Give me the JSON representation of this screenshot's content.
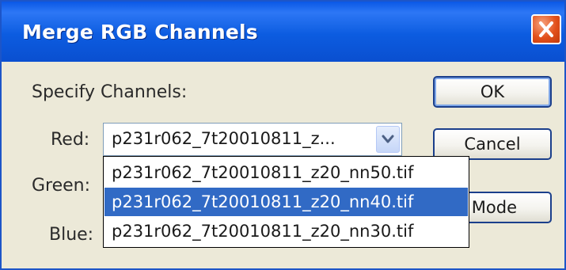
{
  "window": {
    "title": "Merge RGB Channels",
    "close_icon": "close-icon"
  },
  "form": {
    "section_label": "Specify Channels:",
    "red_label": "Red:",
    "green_label": "Green:",
    "blue_label": "Blue:",
    "red_value": "p231r062_7t20010811_z...",
    "dropdown_arrow_icon": "chevron-down-icon",
    "options": [
      {
        "label": "p231r062_7t20010811_z20_nn50.tif",
        "selected": false
      },
      {
        "label": "p231r062_7t20010811_z20_nn40.tif",
        "selected": true
      },
      {
        "label": "p231r062_7t20010811_z20_nn30.tif",
        "selected": false
      }
    ]
  },
  "buttons": {
    "ok": "OK",
    "cancel": "Cancel",
    "mode": "Mode"
  },
  "colors": {
    "title_bar": "#0a58e6",
    "dialog_bg": "#ece9d8",
    "selection": "#316ac5",
    "close_button": "#e2501b"
  }
}
